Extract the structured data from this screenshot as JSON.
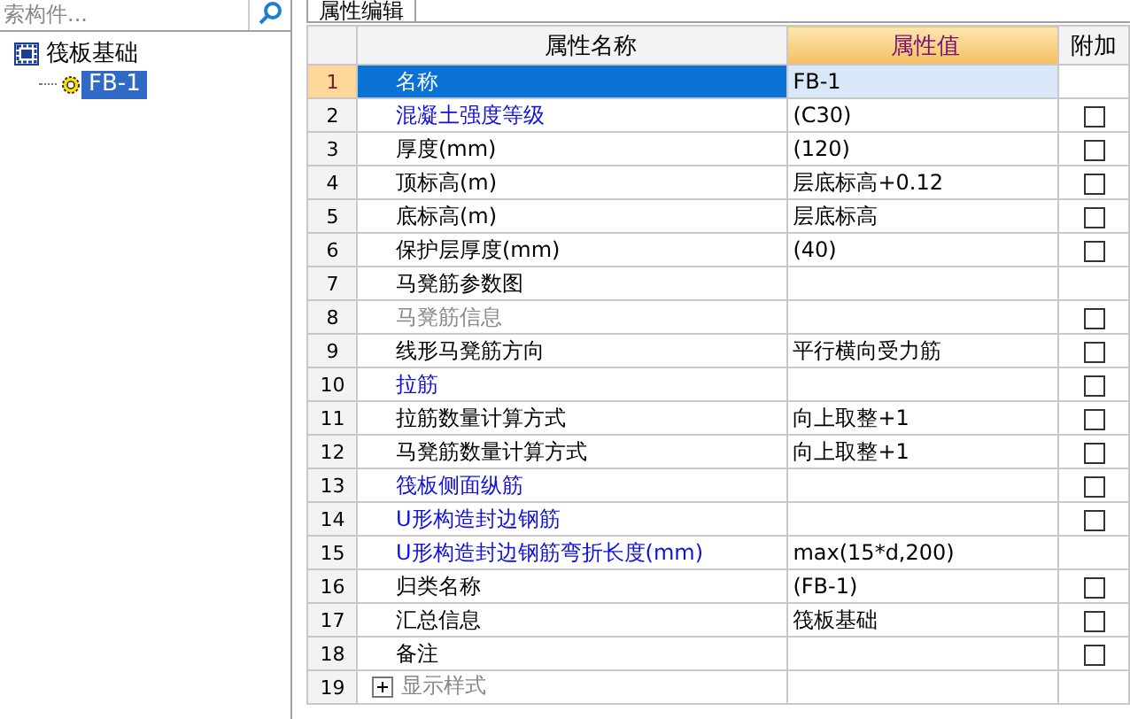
{
  "search": {
    "placeholder": "索构件..."
  },
  "tree": [
    {
      "label": "筏板基础",
      "selected": false,
      "children": [
        {
          "label": "FB-1",
          "selected": true
        }
      ]
    }
  ],
  "tab": {
    "label": "属性编辑",
    "selected": true
  },
  "table": {
    "columns": [
      "属性名称",
      "属性值",
      "附加"
    ],
    "rows": [
      {
        "number": "1",
        "name": "名称",
        "value": "FB-1",
        "kind": "plain",
        "disabled": false,
        "selected": true
      },
      {
        "number": "2",
        "name": "混凝土强度等级",
        "value": "(C30)",
        "kind": "link",
        "disabled": false,
        "selected": false,
        "checked": false
      },
      {
        "number": "3",
        "name": "厚度(mm)",
        "value": "(120)",
        "kind": "plain",
        "disabled": false,
        "selected": false,
        "checked": false
      },
      {
        "number": "4",
        "name": "顶标高(m)",
        "value": "层底标高+0.12",
        "kind": "plain",
        "disabled": false,
        "selected": false,
        "checked": false
      },
      {
        "number": "5",
        "name": "底标高(m)",
        "value": "层底标高",
        "kind": "plain",
        "disabled": false,
        "selected": false,
        "checked": false
      },
      {
        "number": "6",
        "name": "保护层厚度(mm)",
        "value": "(40)",
        "kind": "plain",
        "disabled": false,
        "selected": false,
        "checked": false
      },
      {
        "number": "7",
        "name": "马凳筋参数图",
        "value": "",
        "kind": "plain",
        "disabled": false,
        "selected": false
      },
      {
        "number": "8",
        "name": "马凳筋信息",
        "value": "",
        "kind": "plain",
        "disabled": true,
        "selected": false,
        "checked": false
      },
      {
        "number": "9",
        "name": "线形马凳筋方向",
        "value": "平行横向受力筋",
        "kind": "plain",
        "disabled": false,
        "selected": false,
        "checked": false
      },
      {
        "number": "10",
        "name": "拉筋",
        "value": "",
        "kind": "link",
        "disabled": false,
        "selected": false,
        "checked": false
      },
      {
        "number": "11",
        "name": "拉筋数量计算方式",
        "value": "向上取整+1",
        "kind": "plain",
        "disabled": false,
        "selected": false,
        "checked": false
      },
      {
        "number": "12",
        "name": "马凳筋数量计算方式",
        "value": "向上取整+1",
        "kind": "plain",
        "disabled": false,
        "selected": false,
        "checked": false
      },
      {
        "number": "13",
        "name": "筏板侧面纵筋",
        "value": "",
        "kind": "link",
        "disabled": false,
        "selected": false,
        "checked": false
      },
      {
        "number": "14",
        "name": "U形构造封边钢筋",
        "value": "",
        "kind": "link",
        "disabled": false,
        "selected": false,
        "checked": false
      },
      {
        "number": "15",
        "name": "U形构造封边钢筋弯折长度(mm)",
        "value": "max(15*d,200)",
        "kind": "link",
        "disabled": false,
        "selected": false
      },
      {
        "number": "16",
        "name": "归类名称",
        "value": "(FB-1)",
        "kind": "plain",
        "disabled": false,
        "selected": false,
        "checked": false
      },
      {
        "number": "17",
        "name": "汇总信息",
        "value": "筏板基础",
        "kind": "plain",
        "disabled": false,
        "selected": false,
        "checked": false
      },
      {
        "number": "18",
        "name": "备注",
        "value": "",
        "kind": "plain",
        "disabled": false,
        "selected": false,
        "checked": false
      },
      {
        "number": "19",
        "name": "显示样式",
        "value": "",
        "kind": "plain",
        "disabled": true,
        "selected": false,
        "expanded": false
      }
    ]
  }
}
